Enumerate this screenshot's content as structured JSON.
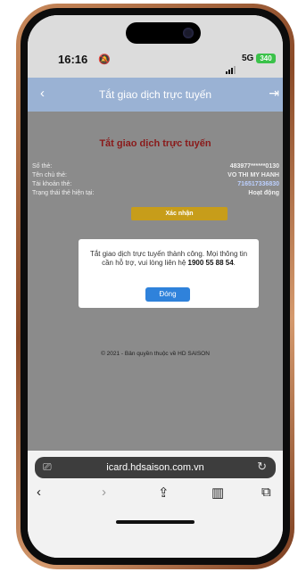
{
  "status": {
    "time": "16:16",
    "network": "5G",
    "battery": "340"
  },
  "appbar": {
    "title": "Tắt giao dịch trực tuyến"
  },
  "content": {
    "title": "Tắt giao dịch trực tuyến",
    "rows": [
      {
        "label": "Số thẻ:",
        "value": "483977******0130"
      },
      {
        "label": "Tên chủ thẻ:",
        "value": "VO THI MY HANH"
      },
      {
        "label": "Tài khoản thẻ:",
        "value": "716517336830"
      },
      {
        "label": "Trạng thái thẻ hiện tại:",
        "value": "Hoạt động"
      }
    ],
    "confirm_label": "Xác nhận",
    "copyright": "© 2021 - Bản quyền thuộc về HD SAISON"
  },
  "modal": {
    "message_pre": "Tắt giao dịch trực tuyến thành công. Mọi thông tin cần hỗ trợ, vui lòng liên hệ ",
    "phone": "1900 55 88 54",
    "message_post": ".",
    "close_label": "Đóng"
  },
  "browser": {
    "url": "icard.hdsaison.com.vn"
  },
  "icons": {
    "back": "back-chevron-icon",
    "logout": "logout-icon",
    "tabs": "tabs-icon",
    "reload": "reload-icon",
    "share": "share-icon",
    "bookmarks": "book-icon",
    "pages": "pages-icon"
  },
  "colors": {
    "appbar": "#9ab2d4",
    "title_red": "#8a1a1a",
    "confirm": "#c79d1a",
    "dong": "#2f82db",
    "overlay": "#8b8b8b"
  }
}
